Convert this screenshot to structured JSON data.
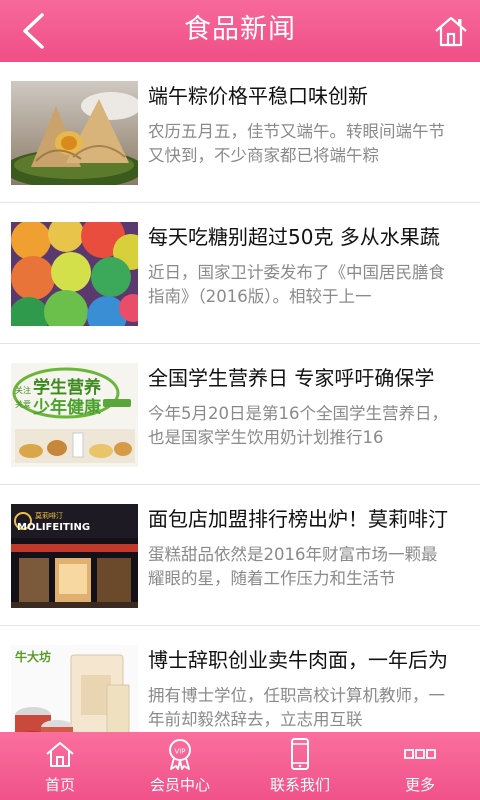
{
  "header": {
    "title": "食品新闻",
    "back_icon": "chevron-left-icon",
    "home_icon": "home-icon"
  },
  "articles": [
    {
      "title": "端午粽价格平稳口味创新",
      "summary": "农历五月五，佳节又端午。转眼间端午节又快到，不少商家都已将端午粽",
      "thumb": "zongzi-photo"
    },
    {
      "title": "每天吃糖别超过50克 多从水果蔬",
      "summary": "近日，国家卫计委发布了《中国居民膳食指南》（2016版）。相较于上一",
      "thumb": "gummy-candy-photo"
    },
    {
      "title": "全国学生营养日 专家呼吁确保学",
      "summary": "今年5月20日是第16个全国学生营养日，也是国家学生饮用奶计划推行16",
      "thumb": "student-nutrition-banner",
      "thumb_text": {
        "line1": "学生营养",
        "line2": "少年健康",
        "prefix_top": "关注",
        "prefix_bottom": "关爱"
      }
    },
    {
      "title": "面包店加盟排行榜出炉！莫莉啡汀",
      "summary": "蛋糕甜品依然是2016年财富市场一颗最耀眼的星，随着工作压力和生活节",
      "thumb": "bakery-storefront-photo",
      "thumb_text": {
        "brand": "MOLIFEITING",
        "brand_cn": "莫莉啡汀"
      }
    },
    {
      "title": "博士辞职创业卖牛肉面，一年后为",
      "summary": "拥有博士学位，任职高校计算机教师，一年前却毅然辞去，立志用互联",
      "thumb": "beef-noodle-products-photo",
      "thumb_text": {
        "brand": "牛大坊"
      }
    }
  ],
  "tabbar": [
    {
      "label": "首页",
      "icon": "home-icon"
    },
    {
      "label": "会员中心",
      "icon": "vip-badge-icon"
    },
    {
      "label": "联系我们",
      "icon": "phone-icon"
    },
    {
      "label": "更多",
      "icon": "more-icon"
    }
  ],
  "colors": {
    "accent": "#f05289",
    "title_text": "#111111",
    "summary_text": "#8a8a8a"
  }
}
